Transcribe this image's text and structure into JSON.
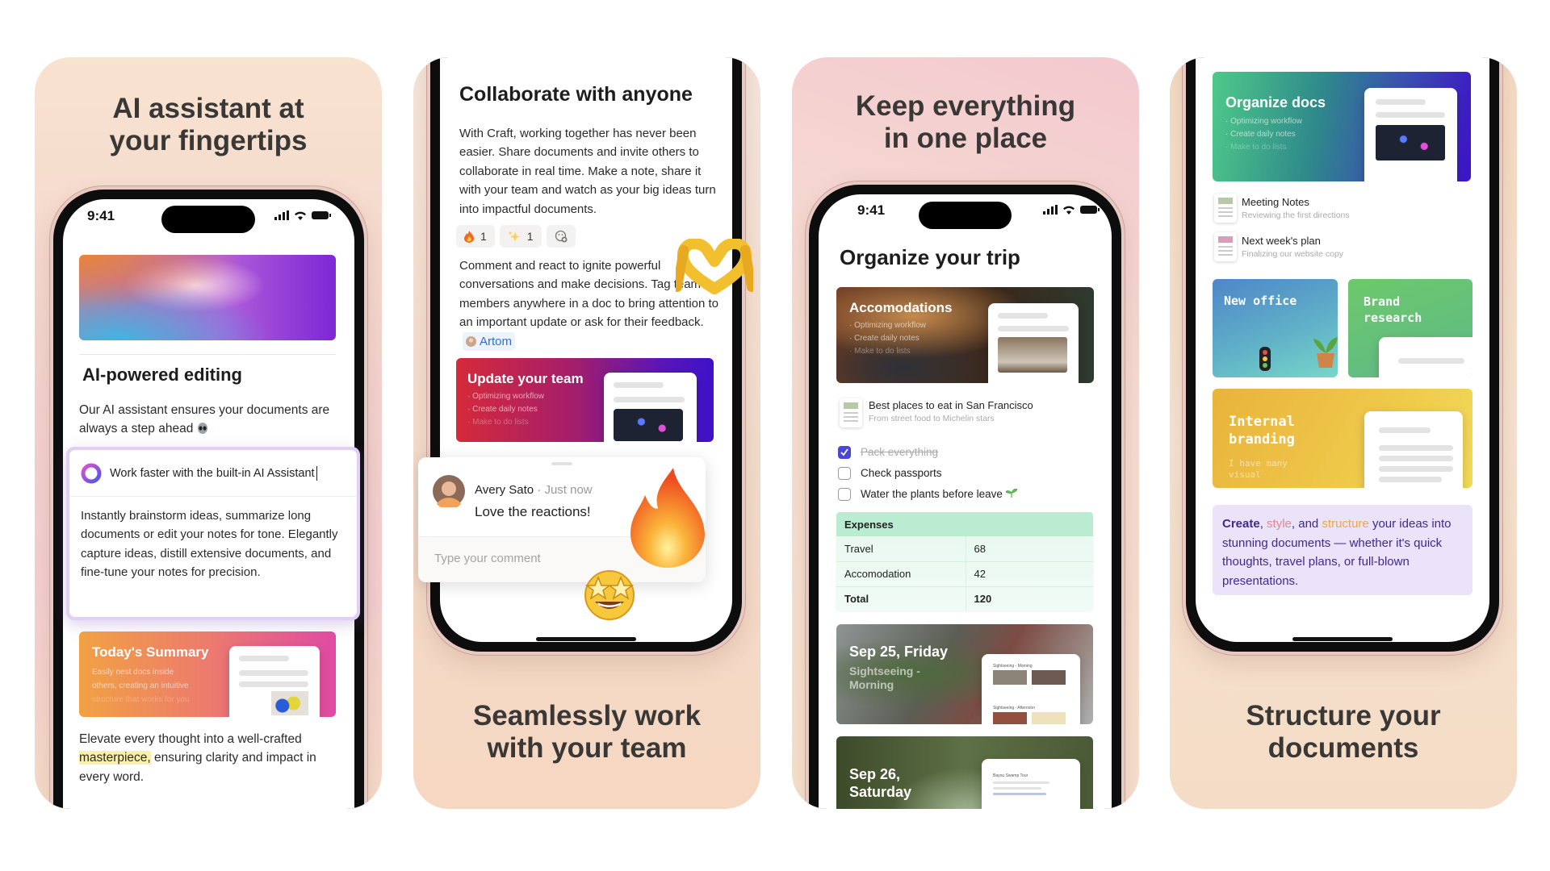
{
  "panels": [
    {
      "title_lines": [
        "AI assistant at",
        "your fingertips"
      ],
      "phone": {
        "time": "9:41",
        "heading": "AI-powered editing",
        "intro": "Our AI assistant ensures your documents are always a step ahead",
        "intro_icon": "alien-emoji-icon",
        "ai_card": {
          "prompt": "Work faster with the built-in AI Assistant",
          "body": "Instantly brainstorm ideas, summarize long documents or edit your notes for tone. Elegantly capture ideas, distill extensive documents, and fine-tune your notes for precision."
        },
        "summary_card": {
          "title": "Today's Summary",
          "lines": [
            "Easily nest docs inside",
            "others, creating an intuitive",
            "structure that works for you"
          ]
        },
        "outro": {
          "before": "Elevate every thought into a well-crafted ",
          "highlight": "masterpiece,",
          "after": " ensuring clarity and impact in every word."
        }
      }
    },
    {
      "title_lines": [
        "Seamlessly work",
        "with your team"
      ],
      "phone": {
        "heading": "Collaborate with anyone",
        "para1": "With Craft, working together has never been easier. Share documents and invite others to collaborate in real time. Make a note, share it with your team and watch as your big ideas turn into impactful documents.",
        "reactions": [
          {
            "icon": "fire-icon",
            "count": "1"
          },
          {
            "icon": "sparkles-icon",
            "count": "1"
          },
          {
            "icon": "add-reaction-icon"
          }
        ],
        "para2": "Comment and react to ignite powerful conversations and make decisions. Tag team members anywhere in a doc to bring attention to an important update or ask for their feedback.",
        "mention": "Artom",
        "update_card": {
          "title": "Update your team",
          "bullets": [
            "Optimizing workflow",
            "Create daily notes",
            "Make to do lists"
          ]
        },
        "comment": {
          "author": "Avery Sato",
          "time": "· Just now",
          "text": "Love the reactions!",
          "placeholder": "Type your comment"
        }
      }
    },
    {
      "title_lines": [
        "Keep everything",
        "in one place"
      ],
      "phone": {
        "time": "9:41",
        "heading": "Organize your trip",
        "accom_card": {
          "title": "Accomodations",
          "bullets": [
            "Optimizing workflow",
            "Create daily notes",
            "Make to do lists"
          ]
        },
        "doc_row": {
          "title": "Best places to eat in San Francisco",
          "subtitle": "From street food to Michelin stars"
        },
        "todos": [
          {
            "label": "Pack everything",
            "checked": true
          },
          {
            "label": "Check passports",
            "checked": false
          },
          {
            "label": "Water the plants before leave",
            "checked": false
          }
        ],
        "expenses": {
          "header": "Expenses",
          "rows": [
            [
              "Travel",
              "68"
            ],
            [
              "Accomodation",
              "42"
            ],
            [
              "Total",
              "120"
            ]
          ]
        },
        "day_cards": [
          {
            "title": "Sep 25, Friday",
            "subtitle": "Sightseeing - Morning",
            "doc_heading": "Sightseeing - Morning",
            "doc_heading2": "Sightseeing - Afternoon"
          },
          {
            "title": "Sep 26, Saturday",
            "doc_heading": "Bayou Swamp Tour"
          }
        ]
      }
    },
    {
      "title_lines": [
        "Structure your",
        "documents"
      ],
      "phone": {
        "organize_card": {
          "title": "Organize docs",
          "bullets": [
            "Optimizing workflow",
            "Create daily notes",
            "Make to do lists"
          ]
        },
        "doc_rows": [
          {
            "title": "Meeting Notes",
            "subtitle": "Reviewing the first directions"
          },
          {
            "title": "Next week's plan",
            "subtitle": "Finalizing our website copy"
          }
        ],
        "tiles": [
          {
            "title": "New office"
          },
          {
            "title": "Brand research"
          }
        ],
        "branding_card": {
          "title": "Internal branding",
          "subtitle": "I have many visual"
        },
        "callout": {
          "w1": "Create",
          "s1": ", ",
          "w2": "style",
          "s2": ", and ",
          "w3": "structure",
          "rest": " your ideas into stunning documents — whether it's quick thoughts, travel plans, or full-blown presentations."
        }
      }
    }
  ],
  "colors": {
    "accent_purple": "#3d2a8a",
    "style_pink": "#e8848f",
    "structure_orange": "#f0a640",
    "checkbox_blue": "#4a47d6",
    "highlight_yellow": "#fbf1a6"
  }
}
